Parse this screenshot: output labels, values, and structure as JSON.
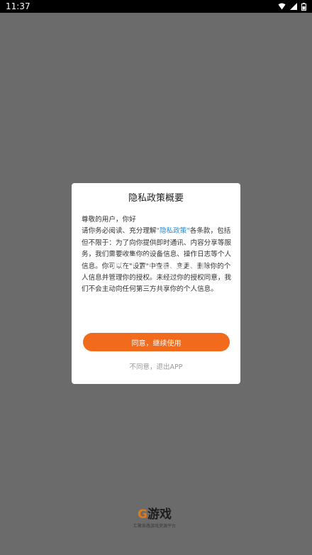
{
  "status_bar": {
    "time": "11:37"
  },
  "dialog": {
    "title": "隐私政策概要",
    "greeting": "尊敬的用户，你好",
    "para_before_link": "请你务必阅读、充分理解",
    "link_text": "\"隐私政策\"",
    "para_after_link": "各条款，包括但不限于：为了向你提供即时通讯、内容分享等服务，我们需要收集你的设备信息、操作日志等个人信息。你可以在\"设置\"中查看、变更、删除你的个人信息并管理你的授权。未经过你的授权同意，我们不会主动向任何第三方共享你的个人信息。",
    "agree_button": "同意，继续使用",
    "disagree_link": "不同意，退出APP"
  },
  "watermark": {
    "text": "K73.com"
  },
  "splash": {
    "logo_g": "G",
    "logo_text": "游戏",
    "slogan": "汇聚各路游戏资源平台"
  },
  "colors": {
    "overlay": "#6b6b6b",
    "accent": "#f26a1b",
    "link": "#2a8bd6"
  }
}
